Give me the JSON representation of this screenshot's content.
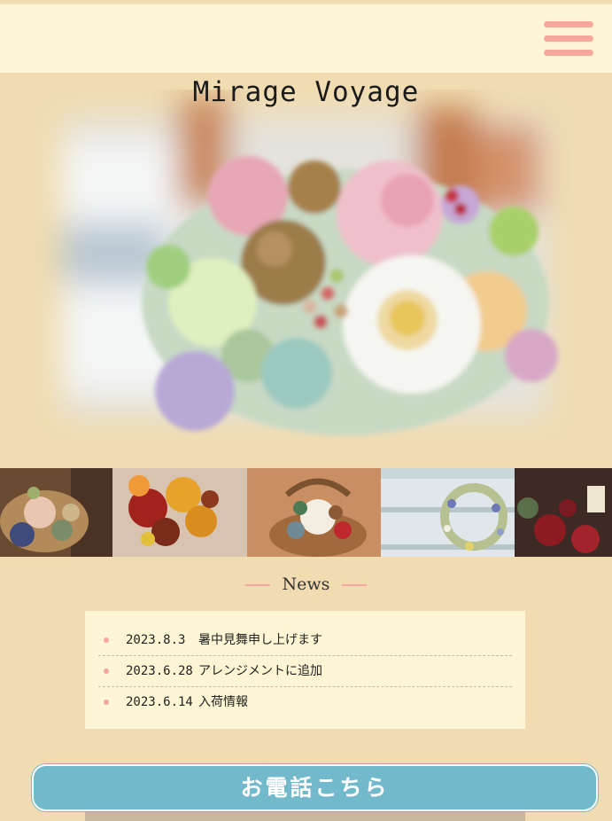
{
  "site": {
    "title": "Mirage Voyage"
  },
  "menu": {
    "icon": "hamburger-menu-icon"
  },
  "news": {
    "heading": "News",
    "items": [
      {
        "date": "2023.8.3",
        "title": "暑中見舞申し上げます"
      },
      {
        "date": "2023.6.28",
        "title": "アレンジメントに追加"
      },
      {
        "date": "2023.6.14",
        "title": "入荷情報"
      }
    ]
  },
  "cta": {
    "label": "お電話こちら"
  },
  "colors": {
    "background": "#f0dcb0",
    "header": "#fdf5d3",
    "accent": "#f4a79a",
    "button": "#73b9cc"
  }
}
